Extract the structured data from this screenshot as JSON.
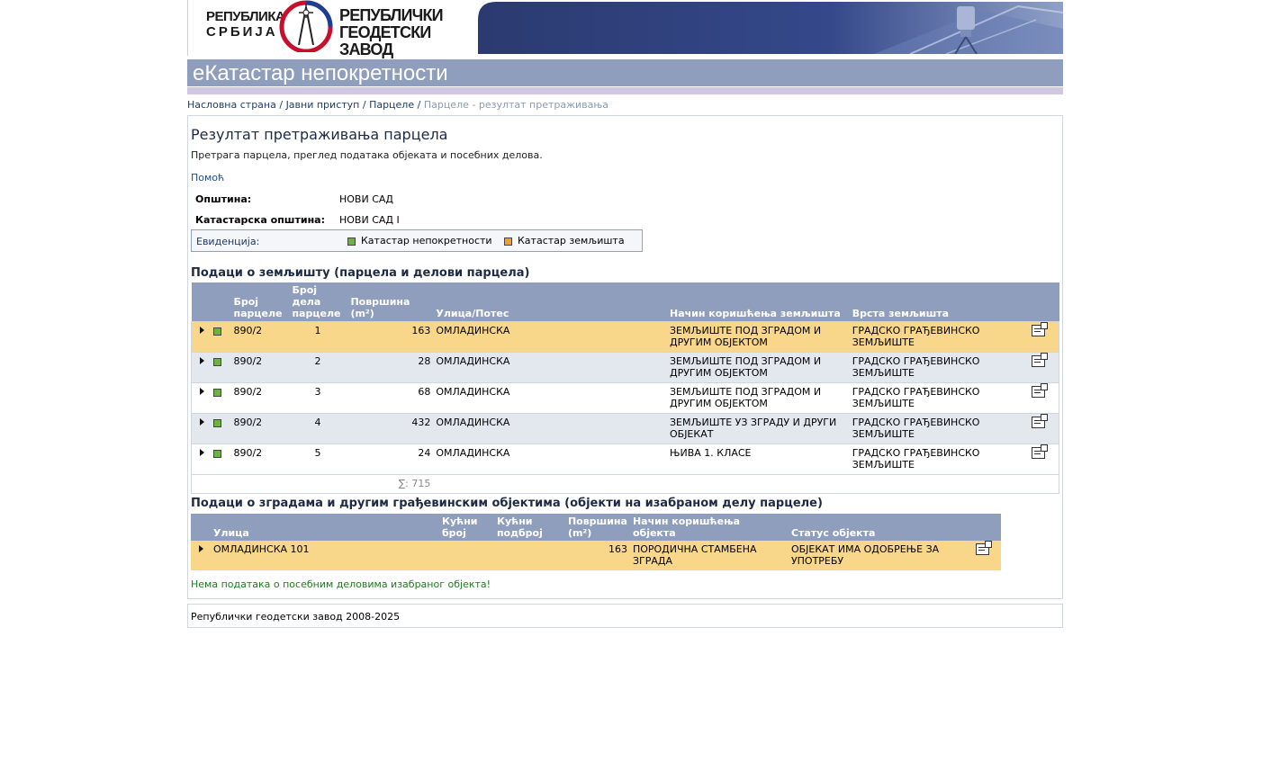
{
  "header": {
    "logo_line1": "РЕПУБЛИКА",
    "logo_line2": "СРБИЈА",
    "agency_line1": "РЕПУБЛИЧКИ",
    "agency_line2": "ГЕОДЕТСКИ ЗАВОД",
    "app_title": "еКатастар непокретности"
  },
  "breadcrumb": {
    "home": "Насловна страна",
    "public": "Јавни приступ",
    "parcels": "Парцеле",
    "current": "Парцеле - резултат претраживања",
    "sep": " / "
  },
  "page": {
    "title": "Резултат претраживања парцела",
    "subtitle": "Претрага парцела, преглед података објеката и посебних делова.",
    "help": "Помоћ"
  },
  "info": {
    "municipality_label": "Општина:",
    "municipality_value": "НОВИ САД",
    "cad_municipality_label": "Катастарска општина:",
    "cad_municipality_value": "НОВИ САД I",
    "evidence_label": "Евиденција:",
    "legend_real_estate": "Катастар непокретности",
    "legend_land": "Катастар земљишта",
    "legend_colors": {
      "real_estate": "#6db33f",
      "land": "#f0a030"
    }
  },
  "land_section": {
    "title": "Подаци о земљишту (парцела и делови парцела)",
    "headers": {
      "parcel_no": "Број парцеле",
      "part_no": "Број дела парцеле",
      "area": "Површина (m²)",
      "street": "Улица/Потес",
      "usage": "Начин коришћења земљишта",
      "land_type": "Врста земљишта"
    },
    "rows": [
      {
        "parcel": "890/2",
        "part": "1",
        "area": "163",
        "street": "ОМЛАДИНСКА",
        "usage": "ЗЕМЉИШТЕ ПОД ЗГРАДОМ И ДРУГИМ ОБЈЕКТОМ",
        "type": "ГРАДСКО ГРАЂЕВИНСКО ЗЕМЉИШТЕ"
      },
      {
        "parcel": "890/2",
        "part": "2",
        "area": "28",
        "street": "ОМЛАДИНСКА",
        "usage": "ЗЕМЉИШТЕ ПОД ЗГРАДОМ И ДРУГИМ ОБЈЕКТОМ",
        "type": "ГРАДСКО ГРАЂЕВИНСКО ЗЕМЉИШТЕ"
      },
      {
        "parcel": "890/2",
        "part": "3",
        "area": "68",
        "street": "ОМЛАДИНСКА",
        "usage": "ЗЕМЉИШТЕ ПОД ЗГРАДОМ И ДРУГИМ ОБЈЕКТОМ",
        "type": "ГРАДСКО ГРАЂЕВИНСКО ЗЕМЉИШТЕ"
      },
      {
        "parcel": "890/2",
        "part": "4",
        "area": "432",
        "street": "ОМЛАДИНСКА",
        "usage": "ЗЕМЉИШТЕ УЗ ЗГРАДУ И ДРУГИ ОБЈЕКАТ",
        "type": "ГРАДСКО ГРАЂЕВИНСКО ЗЕМЉИШТЕ"
      },
      {
        "parcel": "890/2",
        "part": "5",
        "area": "24",
        "street": "ОМЛАДИНСКА",
        "usage": "ЊИВА 1. КЛАСЕ",
        "type": "ГРАДСКО ГРАЂЕВИНСКО ЗЕМЉИШТЕ"
      }
    ],
    "sum": "∑: 715"
  },
  "building_section": {
    "title": "Подаци о зградама и другим грађевинским објектима (објекти на изабраном делу парцеле)",
    "headers": {
      "street": "Улица",
      "house_no": "Кућни број",
      "house_sub": "Кућни подброј",
      "area": "Површина (m²)",
      "usage": "Начин коришћења објекта",
      "status": "Статус објекта"
    },
    "rows": [
      {
        "street": "ОМЛАДИНСКА 101",
        "house_no": "",
        "house_sub": "",
        "area": "163",
        "usage": "ПОРОДИЧНА СТАМБЕНА ЗГРАДА",
        "status": "ОБЈЕКАТ ИМА ОДОБРЕЊЕ ЗА УПОТРЕБУ"
      }
    ],
    "no_data": "Нема података о посебним деловима изабраног објекта!"
  },
  "footer": {
    "text": "Републички геодетски завод 2008-2025"
  }
}
